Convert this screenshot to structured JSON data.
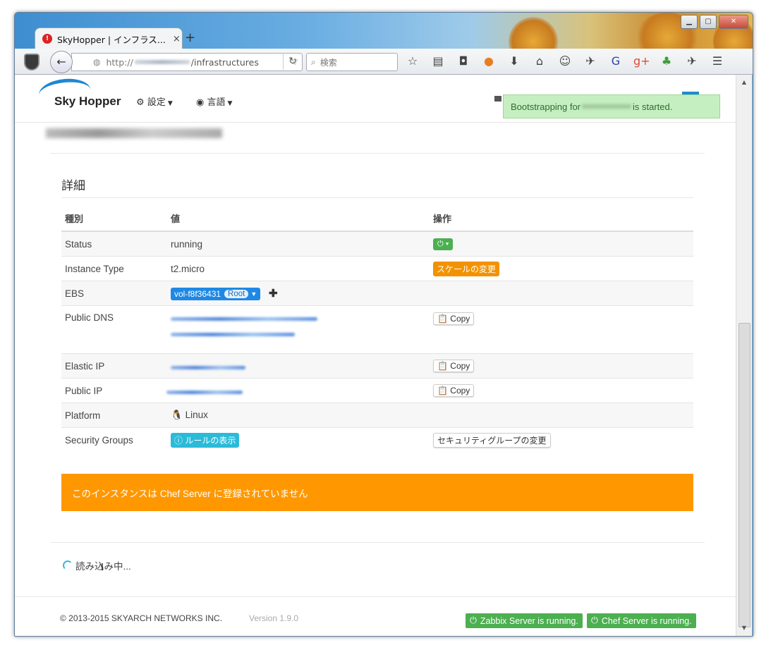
{
  "browser": {
    "tab_title": "SkyHopper | インフラス...",
    "tab_close": "×",
    "new_tab": "+",
    "url_protocol": "http://",
    "url_path": "/infrastructures",
    "search_placeholder": "検索",
    "window_controls": {
      "minimize": "▁",
      "maximize": "▢",
      "close": "✕"
    }
  },
  "app": {
    "logo_text": "Sky Hopper",
    "menu_settings": "設定",
    "menu_language": "言語",
    "toast_prefix": "Bootstrapping for",
    "toast_suffix": "is started."
  },
  "details": {
    "title": "詳細",
    "headers": {
      "type": "種別",
      "value": "値",
      "action": "操作"
    },
    "status_label": "Status",
    "status_value": "running",
    "instance_type_label": "Instance Type",
    "instance_type_value": "t2.micro",
    "scale_button": "スケールの変更",
    "ebs_label": "EBS",
    "ebs_volume": "vol-f8f36431",
    "ebs_badge": "Root",
    "public_dns_label": "Public DNS",
    "elastic_ip_label": "Elastic IP",
    "public_ip_label": "Public IP",
    "copy_label": "Copy",
    "platform_label": "Platform",
    "platform_value": "Linux",
    "security_groups_label": "Security Groups",
    "rules_button": "ルールの表示",
    "sg_change_button": "セキュリティグループの変更"
  },
  "alert_text": "このインスタンスは Chef Server に登録されていません",
  "loading_text": "読み込み中...",
  "footer": {
    "copyright": "© 2013-2015 SKYARCH NETWORKS INC.",
    "version": "Version 1.9.0",
    "zabbix_status": "Zabbix Server is running.",
    "chef_status": "Chef Server is running."
  },
  "colors": {
    "green": "#4caf50",
    "orange": "#f39200",
    "alert": "#ff9800",
    "blue": "#1e88e5",
    "cyan": "#2bbbd8"
  }
}
